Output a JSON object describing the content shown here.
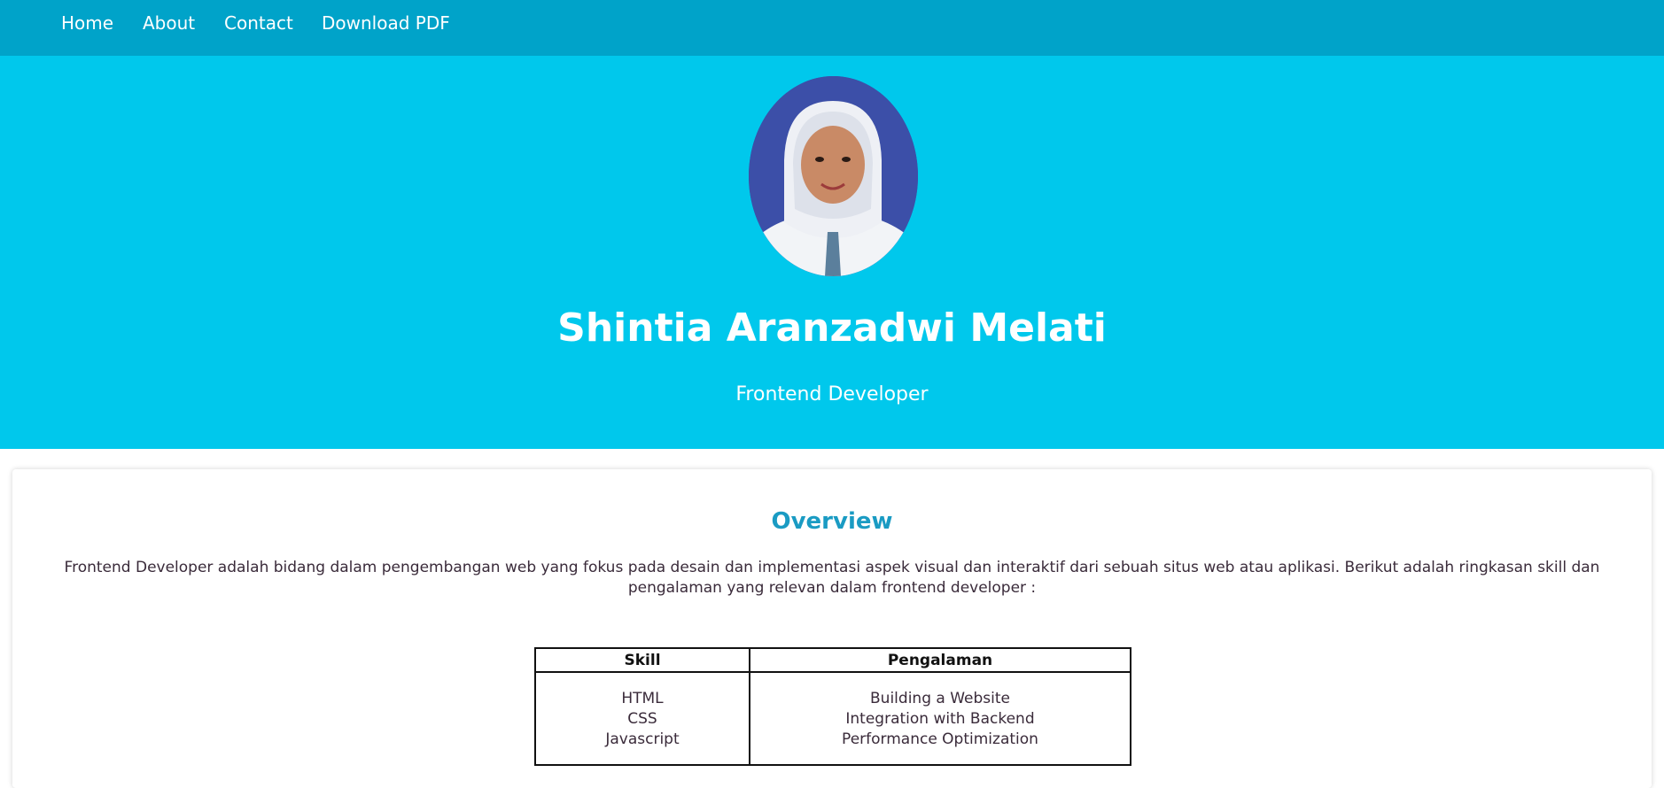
{
  "nav": {
    "items": [
      {
        "label": "Home"
      },
      {
        "label": "About"
      },
      {
        "label": "Contact"
      },
      {
        "label": "Download PDF"
      }
    ]
  },
  "hero": {
    "name": "Shintia Aranzadwi Melati",
    "role": "Frontend Developer",
    "avatar_icon": "profile-photo"
  },
  "overview": {
    "title": "Overview",
    "text": "Frontend Developer adalah bidang dalam pengembangan web yang fokus pada desain dan implementasi aspek visual dan interaktif dari sebuah situs web atau aplikasi. Berikut adalah ringkasan skill dan pengalaman yang relevan dalam frontend developer :",
    "table": {
      "headers": [
        "Skill",
        "Pengalaman"
      ],
      "skills": [
        "HTML",
        "CSS",
        "Javascript"
      ],
      "experience": [
        "Building a Website",
        "Integration with Backend",
        "Performance Optimization"
      ]
    }
  },
  "colors": {
    "navbar": "#00a3c9",
    "hero": "#00c8ec",
    "accent": "#1a9bc3"
  }
}
